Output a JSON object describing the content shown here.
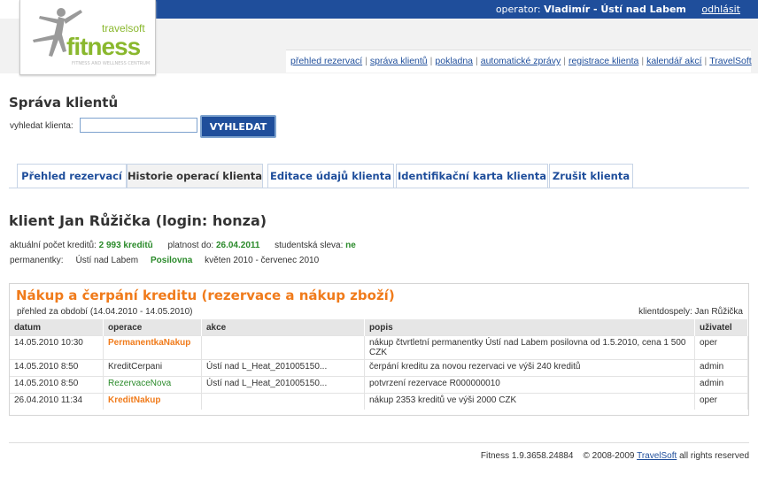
{
  "header": {
    "operator_label": "operator:",
    "operator_name": "Vladimír - Ústí nad Labem",
    "logout": "odhlásit"
  },
  "logo": {
    "brand_small": "travelsoft",
    "brand_big": "fitness",
    "tagline": "FITNESS AND WELLNESS CENTRUM"
  },
  "topnav": [
    "přehled rezervací",
    "správa klientů",
    "pokladna",
    "automatické zprávy",
    "registrace klienta",
    "kalendář akcí",
    "TravelSoft"
  ],
  "page_title": "Správa klientů",
  "search": {
    "label": "vyhledat klienta:",
    "value": "",
    "button": "VYHLEDAT"
  },
  "tabs": [
    "Přehled rezervací",
    "Historie operací klienta",
    "Editace údajů klienta",
    "Identifikační karta klienta",
    "Zrušit klienta"
  ],
  "active_tab": 1,
  "client": {
    "heading": "klient Jan Růžička (login: honza)",
    "credits_label": "aktuální počet kreditů:",
    "credits_value": "2 993 kreditů",
    "validity_label": "platnost do:",
    "validity_value": "26.04.2011",
    "student_label": "studentská sleva:",
    "student_value": "ne",
    "passes_label": "permanentky:",
    "pass_place": "Ústí nad Labem",
    "pass_type": "Posilovna",
    "pass_period": "květen 2010 - červenec 2010"
  },
  "panel": {
    "title": "Nákup a čerpání kreditu (rezervace a nákup zboží)",
    "period": "přehled za období (14.04.2010 - 14.05.2010)",
    "client_type": "klientdospely: Jan Růžička",
    "columns": [
      "datum",
      "operace",
      "akce",
      "popis",
      "uživatel"
    ],
    "rows": [
      {
        "datum": "14.05.2010 10:30",
        "operace": "PermanentkaNakup",
        "op_style": "orange",
        "akce": "",
        "popis": "nákup čtvrtletní permanentky Ústí nad Labem posilovna od 1.5.2010, cena 1 500 CZK",
        "uzivatel": "oper"
      },
      {
        "datum": "14.05.2010 8:50",
        "operace": "KreditCerpani",
        "op_style": "plain",
        "akce": "Ústí nad L_Heat_201005150...",
        "popis": "čerpání kreditu za novou rezervaci ve výši 240 kreditů",
        "uzivatel": "admin"
      },
      {
        "datum": "14.05.2010 8:50",
        "operace": "RezervaceNova",
        "op_style": "green",
        "akce": "Ústí nad L_Heat_201005150...",
        "popis": "potvrzení rezervace R000000010",
        "uzivatel": "admin"
      },
      {
        "datum": "26.04.2010 11:34",
        "operace": "KreditNakup",
        "op_style": "orange",
        "akce": "",
        "popis": "nákup 2353 kreditů ve výši 2000 CZK",
        "uzivatel": "oper"
      }
    ]
  },
  "footer": {
    "version": "Fitness 1.9.3658.24884",
    "copyright": "© 2008-2009",
    "company": "TravelSoft",
    "rights": "all rights reserved"
  },
  "colors": {
    "brand_blue": "#1f4e9b",
    "accent_orange": "#f07b1b",
    "green": "#2a8a2a",
    "logo_green": "#8ab82e"
  }
}
